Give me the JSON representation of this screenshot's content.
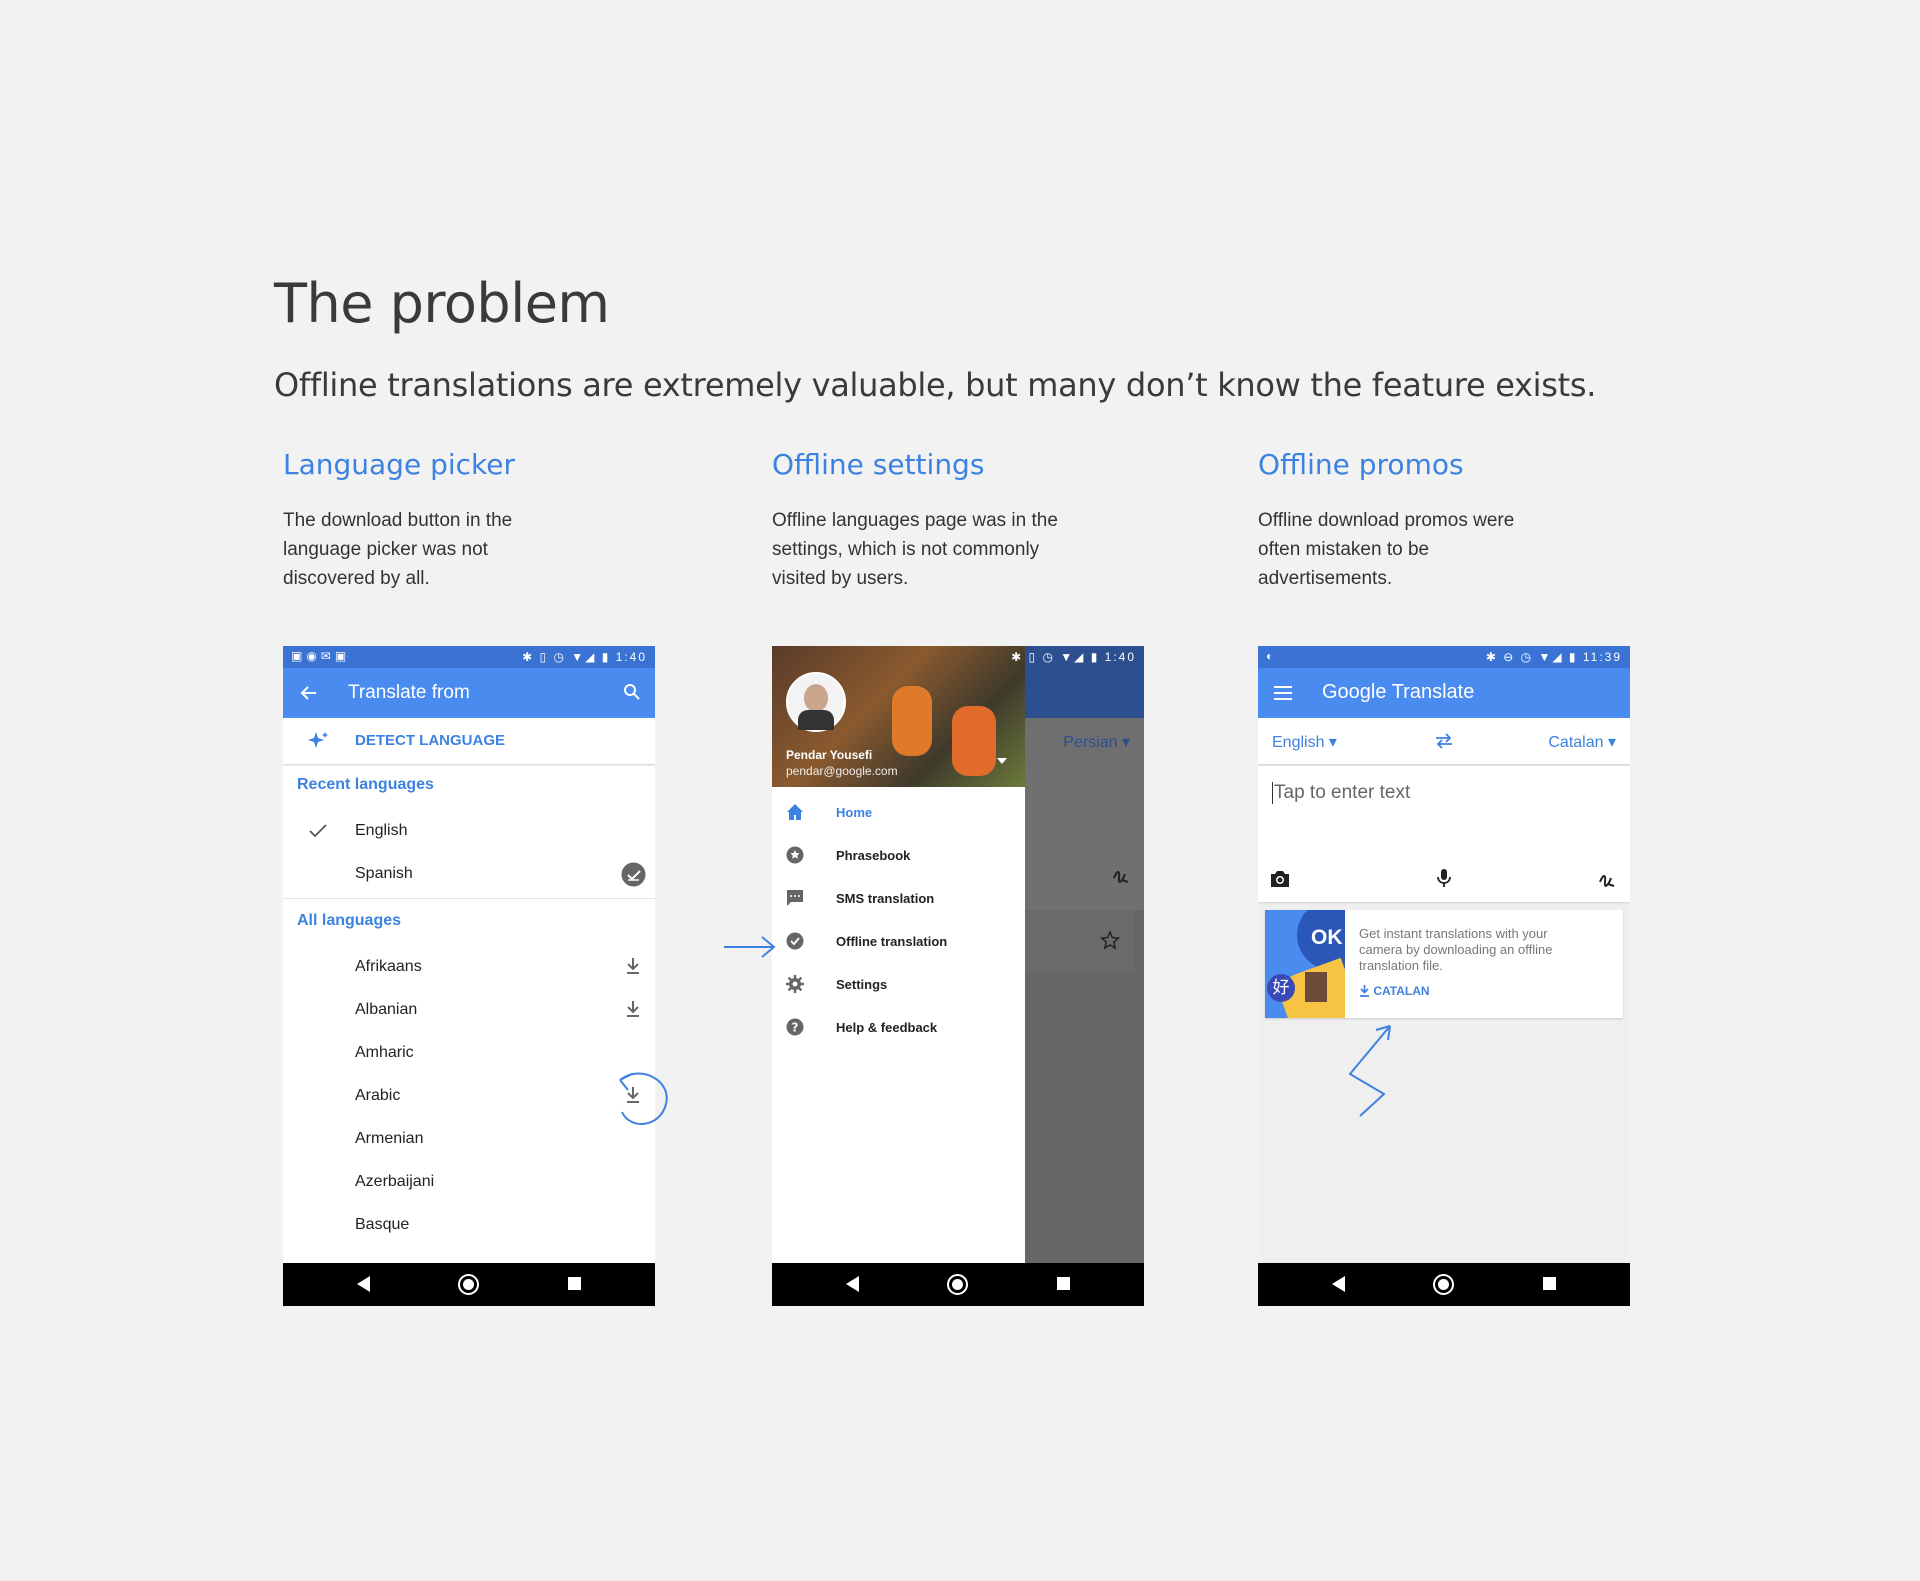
{
  "page": {
    "title": "The problem",
    "subtitle": "Offline translations are extremely valuable, but many don’t know the feature exists."
  },
  "columns": [
    {
      "heading": "Language picker",
      "desc": [
        "The download button in the",
        "language picker was not",
        "discovered by all."
      ]
    },
    {
      "heading": "Offline settings",
      "desc": [
        "Offline languages page was in the",
        "settings, which is not commonly",
        "visited by users."
      ]
    },
    {
      "heading": "Offline promos",
      "desc": [
        "Offline download promos were",
        "often mistaken to be",
        "advertisements."
      ]
    }
  ],
  "phone1": {
    "time": "1:40",
    "appbar_title": "Translate from",
    "detect": "DETECT LANGUAGE",
    "recent_header": "Recent languages",
    "recent": [
      "English",
      "Spanish"
    ],
    "all_header": "All languages",
    "languages": [
      "Afrikaans",
      "Albanian",
      "Amharic",
      "Arabic",
      "Armenian",
      "Azerbaijani",
      "Basque"
    ]
  },
  "phone2": {
    "time": "1:40",
    "account_name": "Pendar Yousefi",
    "account_email": "pendar@google.com",
    "bg_language": "Persian",
    "menu": [
      "Home",
      "Phrasebook",
      "SMS translation",
      "Offline translation",
      "Settings",
      "Help & feedback"
    ]
  },
  "phone3": {
    "time": "11:39",
    "app_title": "Google Translate",
    "source_lang": "English",
    "target_lang": "Catalan",
    "input_placeholder": "Tap to enter text",
    "promo_ok": "OK",
    "promo_glyph": "好",
    "promo_text": [
      "Get instant translations with your",
      "camera by downloading an offline",
      "translation file."
    ],
    "promo_action": "CATALAN"
  },
  "colors": {
    "accent": "#3d82e0",
    "appbar": "#4a8bf0",
    "statusbar": "#3b73d4",
    "background": "#f2f2f2"
  }
}
